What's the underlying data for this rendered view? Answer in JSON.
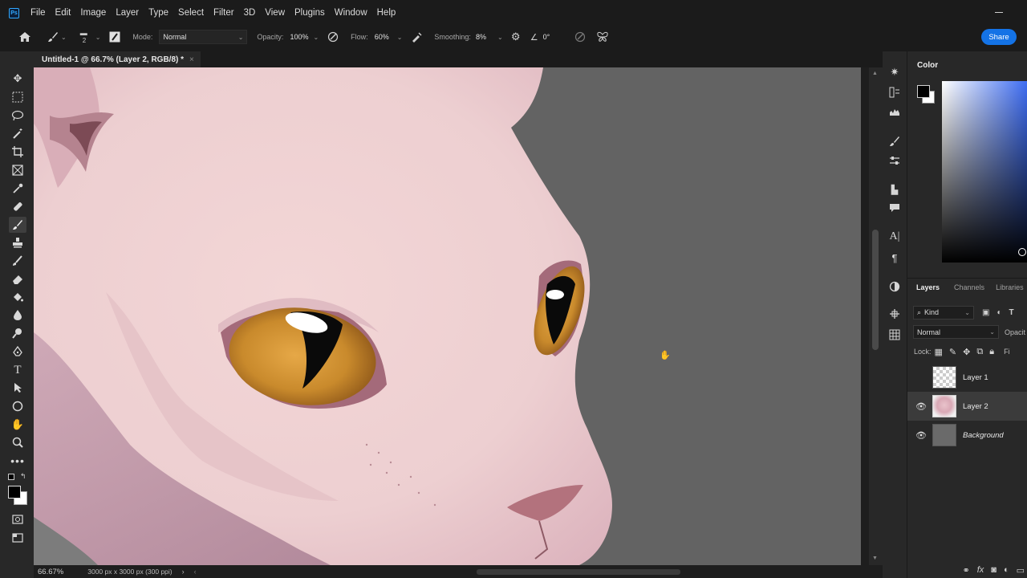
{
  "app": {
    "logo_text": "Ps",
    "menu": [
      "File",
      "Edit",
      "Image",
      "Layer",
      "Type",
      "Select",
      "Filter",
      "3D",
      "View",
      "Plugins",
      "Window",
      "Help"
    ]
  },
  "options": {
    "brush_size": "2",
    "mode_label": "Mode:",
    "mode_value": "Normal",
    "opacity_label": "Opacity:",
    "opacity_value": "100%",
    "flow_label": "Flow:",
    "flow_value": "60%",
    "smoothing_label": "Smoothing:",
    "smoothing_value": "8%",
    "angle_value": "0°",
    "share_label": "Share"
  },
  "document": {
    "tab_title": "Untitled-1 @ 66.7% (Layer 2, RGB/8) *",
    "close_glyph": "×"
  },
  "status": {
    "zoom": "66.67%",
    "doc_info": "3000 px x 3000 px (300 ppi)",
    "arrow": "›",
    "scroll_left": "‹"
  },
  "color_panel": {
    "tab": "Color",
    "foreground": "#000000",
    "background": "#ffffff",
    "hue": "#3d6cf2"
  },
  "layers_panel": {
    "tabs": [
      "Layers",
      "Channels",
      "Libraries",
      "P"
    ],
    "kind_label": "Kind",
    "blend_mode": "Normal",
    "opacity_label": "Opacit",
    "lock_label": "Lock:",
    "fill_label": "Fi",
    "layers": [
      {
        "name": "Layer 1",
        "visible": false,
        "selected": false
      },
      {
        "name": "Layer 2",
        "visible": true,
        "selected": true
      },
      {
        "name": "Background",
        "visible": true,
        "selected": false
      }
    ],
    "footer_fx": "fx"
  },
  "colors": {
    "accent": "#1473e6",
    "canvas_bg": "#636363",
    "skin": "#efcfd1",
    "iris": "#c98a2c"
  }
}
